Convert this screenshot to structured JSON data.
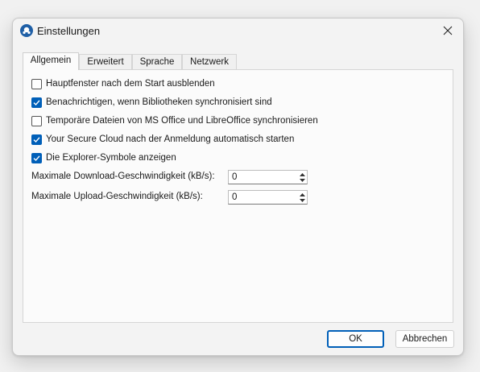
{
  "window": {
    "title": "Einstellungen",
    "icon": "app-logo-icon"
  },
  "tabs": [
    {
      "label": "Allgemein",
      "active": true
    },
    {
      "label": "Erweitert",
      "active": false
    },
    {
      "label": "Sprache",
      "active": false
    },
    {
      "label": "Netzwerk",
      "active": false
    }
  ],
  "general": {
    "checkboxes": [
      {
        "label": "Hauptfenster nach dem Start ausblenden",
        "checked": false
      },
      {
        "label": "Benachrichtigen, wenn Bibliotheken synchronisiert sind",
        "checked": true
      },
      {
        "label": "Temporäre Dateien von MS Office und LibreOffice synchronisieren",
        "checked": false
      },
      {
        "label": "Your Secure Cloud nach der Anmeldung automatisch starten",
        "checked": true
      },
      {
        "label": "Die Explorer-Symbole anzeigen",
        "checked": true
      }
    ],
    "download": {
      "label": "Maximale Download-Geschwindigkeit (kB/s):",
      "value": "0"
    },
    "upload": {
      "label": "Maximale Upload-Geschwindigkeit (kB/s):",
      "value": "0"
    }
  },
  "buttons": {
    "ok": "OK",
    "cancel": "Abbrechen"
  },
  "colors": {
    "accent": "#005fb8",
    "app_icon": "#1f5fa6"
  }
}
